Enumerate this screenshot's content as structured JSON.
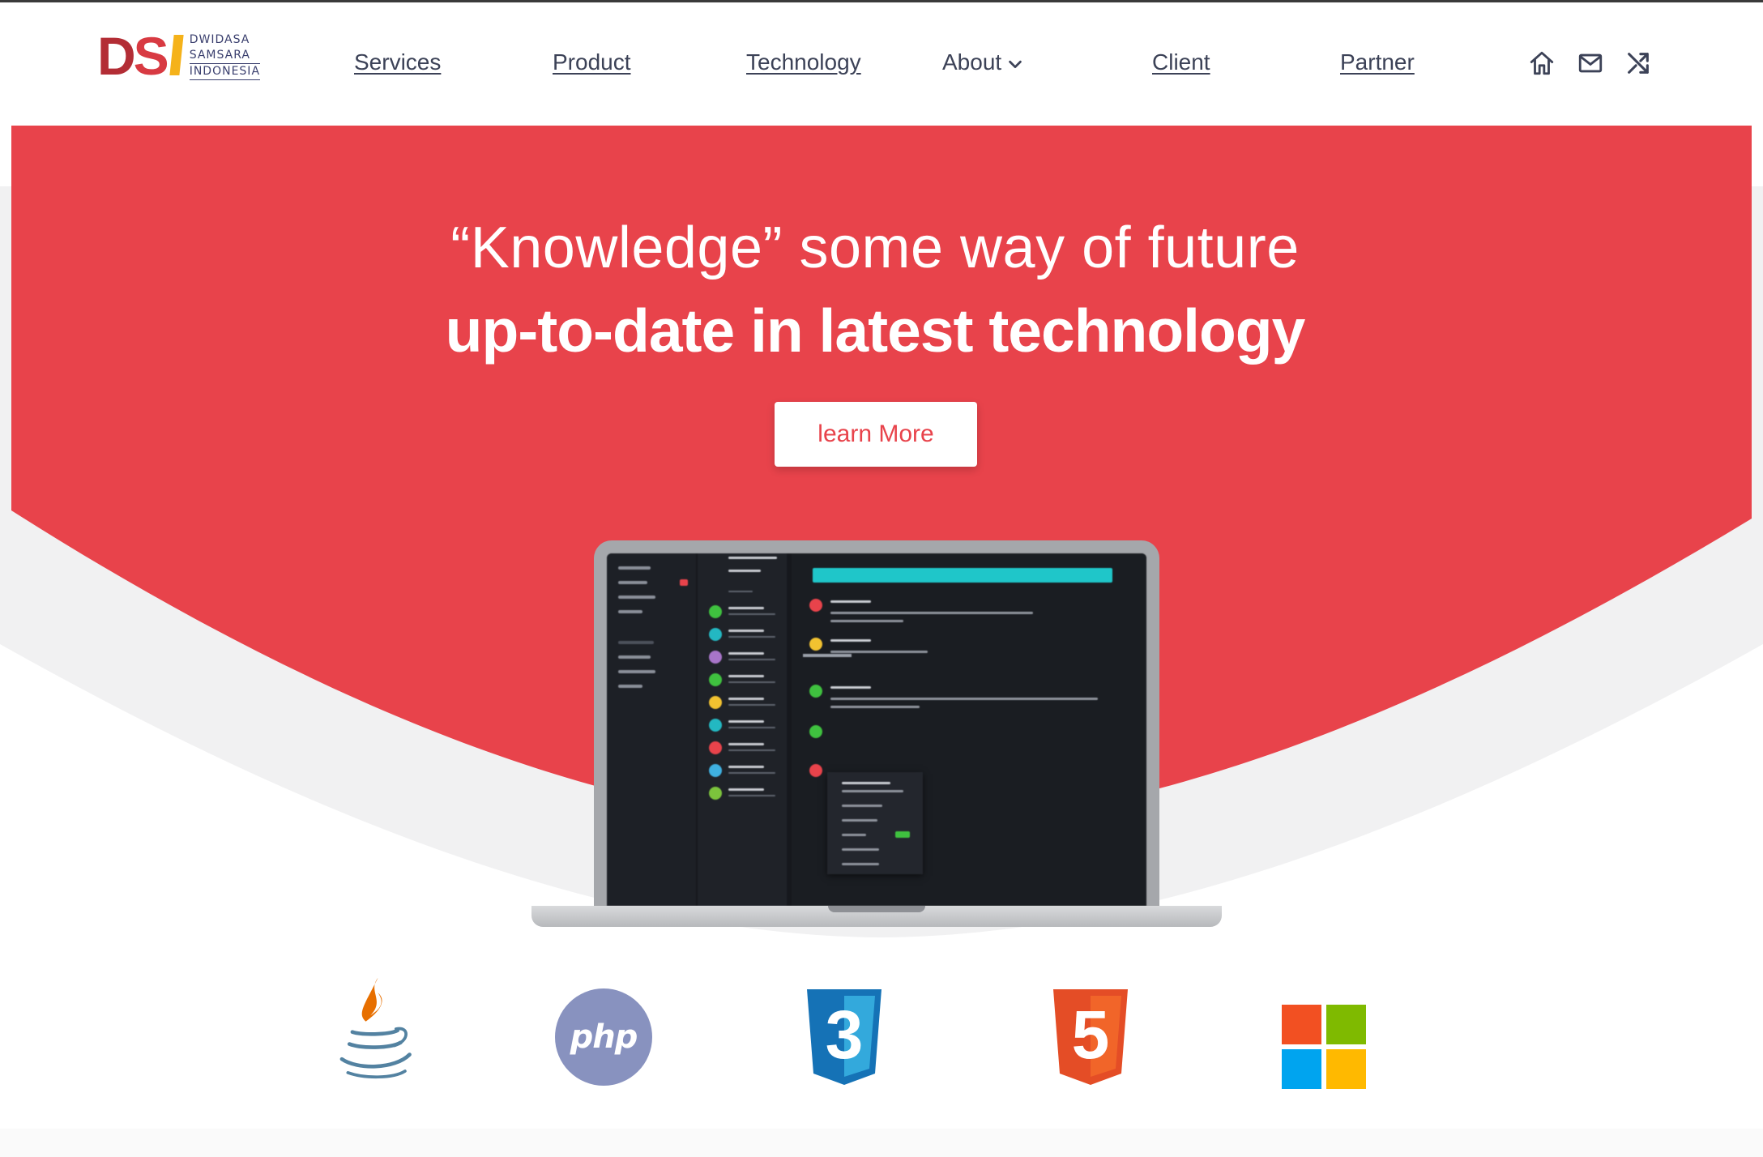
{
  "header": {
    "logo": {
      "mark": "DSI",
      "words": [
        "DWIDASA",
        "SAMSARA",
        "INDONESIA"
      ]
    },
    "nav": [
      {
        "label": "Services"
      },
      {
        "label": "Product"
      },
      {
        "label": "Technology"
      },
      {
        "label": "About"
      },
      {
        "label": "Client"
      },
      {
        "label": "Partner"
      }
    ],
    "icons": [
      "home-icon",
      "mail-icon",
      "shuffle-icon"
    ]
  },
  "hero": {
    "line1": "“Knowledge” some way of future",
    "line2": "up-to-date in latest technology",
    "cta_label": "learn More",
    "colors": {
      "accent": "#e8434b",
      "curve_shadow": "#f1f1f2"
    }
  },
  "tech_logos": [
    "java-logo",
    "php-logo",
    "css3-logo",
    "html5-logo",
    "microsoft-logo"
  ],
  "tech_logo_text": {
    "php": "php",
    "css": "3",
    "html": "5"
  }
}
